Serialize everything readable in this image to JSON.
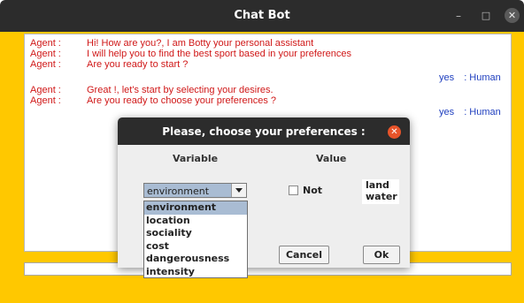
{
  "window": {
    "title": "Chat Bot",
    "min_glyph": "–",
    "max_glyph": "□",
    "close_glyph": "✕"
  },
  "colors": {
    "frame": "#ffc800",
    "agent_text": "#d01818",
    "human_text": "#1f3fbf",
    "selection": "#a9bcd3"
  },
  "chat": {
    "messages": [
      {
        "speaker": "Agent :",
        "text": "Hi! How are you?, I am Botty your personal assistant"
      },
      {
        "speaker": "Agent :",
        "text": "I will help you to find the best sport based in your preferences"
      },
      {
        "speaker": "Agent :",
        "text": "Are you ready to start ?"
      },
      {
        "reply": "yes",
        "speaker": ": Human"
      },
      {
        "speaker": "Agent :",
        "text": "Great !, let's start by selecting your desires."
      },
      {
        "speaker": "Agent :",
        "text": "Are you ready to choose your preferences ?"
      },
      {
        "reply": "yes",
        "speaker": ": Human"
      }
    ]
  },
  "input": {
    "value": ""
  },
  "dialog": {
    "title": "Please, choose your preferences :",
    "close_glyph": "✕",
    "col_variable": "Variable",
    "col_value": "Value",
    "selected_variable": "environment",
    "not_label": "Not",
    "not_checked": false,
    "values": [
      "land",
      "water"
    ],
    "cancel_label": "Cancel",
    "ok_label": "Ok"
  },
  "dropdown": {
    "options": [
      "environment",
      "location",
      "sociality",
      "cost",
      "dangerousness",
      "intensity"
    ],
    "selected_index": 0
  }
}
